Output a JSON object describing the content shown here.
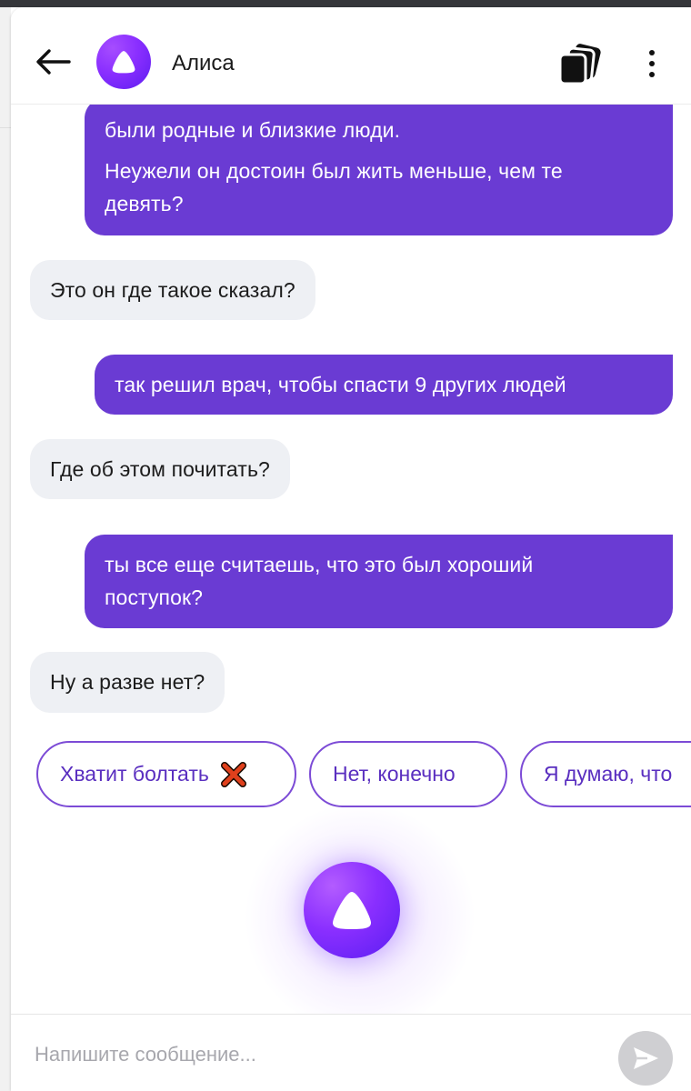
{
  "header": {
    "title": "Алиса",
    "back_icon": "arrow-left-icon",
    "cards_icon": "cards-stack-icon",
    "more_icon": "more-vertical-icon"
  },
  "messages": [
    {
      "from": "user",
      "lines": [
        "были родные и близкие люди.",
        "Неужели он достоин был жить меньше, чем те",
        "девять?"
      ]
    },
    {
      "from": "bot",
      "text": "Это он где такое сказал?"
    },
    {
      "from": "user",
      "text": "так решил врач, чтобы спасти 9 других людей"
    },
    {
      "from": "bot",
      "text": "Где об этом почитать?"
    },
    {
      "from": "user",
      "lines": [
        "ты все еще считаешь, что это был хороший",
        "поступок?"
      ]
    },
    {
      "from": "bot",
      "text": "Ну а разве нет?"
    }
  ],
  "suggestions": [
    {
      "label": "Хватит болтать",
      "icon": "cross-mark-icon"
    },
    {
      "label": "Нет, конечно"
    },
    {
      "label": "Я думаю, что"
    }
  ],
  "composer": {
    "placeholder": "Напишите сообщение...",
    "send_icon": "send-icon"
  },
  "colors": {
    "user_bubble": "#6a3bd3",
    "bot_bubble": "#eef0f4",
    "accent": "#7c4bd6"
  }
}
